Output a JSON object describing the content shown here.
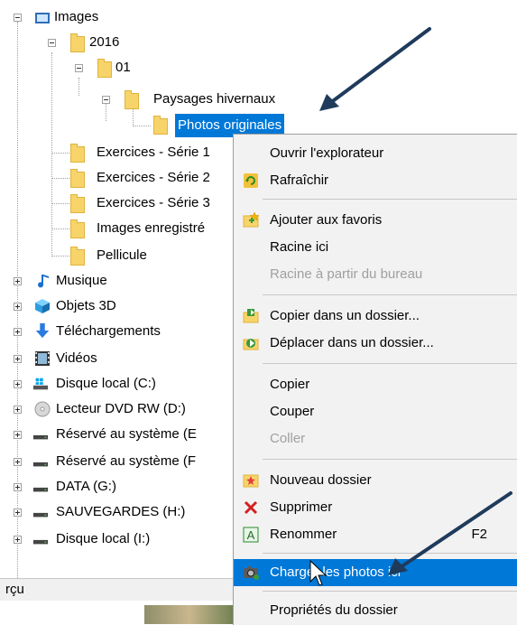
{
  "tree": {
    "images": "Images",
    "y2016": "2016",
    "f01": "01",
    "paysages": "Paysages hivernaux",
    "photos_originales": "Photos originales",
    "ex1": "Exercices - Série 1",
    "ex2": "Exercices - Série 2",
    "ex3": "Exercices - Série 3",
    "images_enreg": "Images enregistré",
    "pellicule": "Pellicule",
    "musique": "Musique",
    "objets3d": "Objets 3D",
    "telechargements": "Téléchargements",
    "videos": "Vidéos",
    "disque_c": "Disque local (C:)",
    "dvd": "Lecteur DVD RW (D:)",
    "reserve_e": "Réservé au système (E",
    "reserve_f": "Réservé au système (F",
    "data_g": "DATA (G:)",
    "sauvegardes": "SAUVEGARDES (H:)",
    "disque_i": "Disque local (I:)"
  },
  "bottom": {
    "label": "rçu"
  },
  "menu": {
    "ouvrir": "Ouvrir l'explorateur",
    "rafraichir": "Rafraîchir",
    "favoris": "Ajouter aux favoris",
    "racine": "Racine ici",
    "racine_bureau": "Racine à partir du bureau",
    "copier_dossier": "Copier dans un dossier...",
    "deplacer_dossier": "Déplacer dans un dossier...",
    "copier": "Copier",
    "couper": "Couper",
    "coller": "Coller",
    "nouveau": "Nouveau dossier",
    "supprimer": "Supprimer",
    "renommer": "Renommer",
    "renommer_key": "F2",
    "charger": "Charger les photos ici",
    "proprietes": "Propriétés du dossier"
  },
  "colors": {
    "selection": "#0078d7",
    "arrow": "#1f3b5c",
    "folder": "#f7d46a"
  }
}
